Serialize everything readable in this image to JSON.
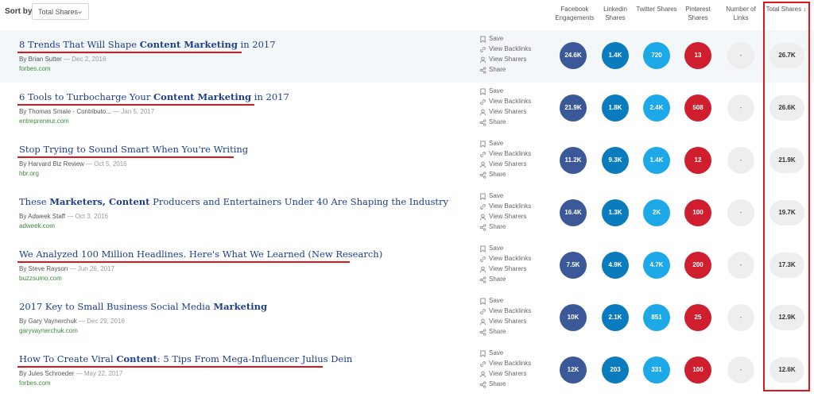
{
  "sort": {
    "label": "Sort by",
    "selected": "Total Shares"
  },
  "columns": {
    "facebook": "Facebook Engagements",
    "linkedin": "Linkedin Shares",
    "twitter": "Twitter Shares",
    "pinterest": "Pinterest Shares",
    "links": "Number of Links",
    "total": "Total Shares ↓"
  },
  "actions": {
    "save": "Save",
    "backlinks": "View Backlinks",
    "sharers": "View Sharers",
    "share": "Share"
  },
  "colors": {
    "facebook": "#3b5998",
    "linkedin": "#0a7bbc",
    "twitter": "#1da8e8",
    "pinterest": "#cf1f2e",
    "highlight": "#e0161e",
    "title": "#1f3e8c",
    "domain": "#3f8c3f"
  },
  "articles": [
    {
      "title_parts": [
        [
          "8 Trends That Will Shape ",
          false
        ],
        [
          "Content Marketing",
          true
        ],
        [
          " in 2017",
          false
        ]
      ],
      "underlined": true,
      "author": "By Brian Sutter",
      "date": "— Dec 2, 2016",
      "domain": "forbes.com",
      "facebook": "24.6K",
      "linkedin": "1.4K",
      "twitter": "720",
      "pinterest": "13",
      "links": "-",
      "total": "26.7K"
    },
    {
      "title_parts": [
        [
          "6 Tools to Turbocharge Your ",
          false
        ],
        [
          "Content Marketing",
          true
        ],
        [
          " in 2017",
          false
        ]
      ],
      "underlined": true,
      "author": "By Thomas Smale - Contributo...",
      "date": "— Jan 5, 2017",
      "domain": "entrepreneur.com",
      "facebook": "21.9K",
      "linkedin": "1.8K",
      "twitter": "2.4K",
      "pinterest": "508",
      "links": "-",
      "total": "26.6K"
    },
    {
      "title_parts": [
        [
          "Stop Trying to Sound Smart When You're Writing",
          false
        ]
      ],
      "underlined": true,
      "author": "By Harvard Biz Review",
      "date": "— Oct 5, 2016",
      "domain": "hbr.org",
      "facebook": "11.2K",
      "linkedin": "9.3K",
      "twitter": "1.4K",
      "pinterest": "12",
      "links": "-",
      "total": "21.9K"
    },
    {
      "title_parts": [
        [
          "These ",
          false
        ],
        [
          "Marketers, Content",
          true
        ],
        [
          " Producers and Entertainers Under 40 Are Shaping the Industry",
          false
        ]
      ],
      "underlined": false,
      "author": "By Adweek Staff",
      "date": "— Oct 3, 2016",
      "domain": "adweek.com",
      "facebook": "16.4K",
      "linkedin": "1.3K",
      "twitter": "2K",
      "pinterest": "100",
      "links": "-",
      "total": "19.7K"
    },
    {
      "title_parts": [
        [
          "We Analyzed 100 Million Headlines. Here's What We Learned (New Research)",
          false
        ]
      ],
      "underlined": true,
      "author": "By Steve Rayson",
      "date": "— Jun 26, 2017",
      "domain": "buzzsumo.com",
      "facebook": "7.5K",
      "linkedin": "4.9K",
      "twitter": "4.7K",
      "pinterest": "200",
      "links": "-",
      "total": "17.3K"
    },
    {
      "title_parts": [
        [
          "2017 Key to Small Business Social Media ",
          false
        ],
        [
          "Marketing",
          true
        ]
      ],
      "underlined": false,
      "author": "By Gary Vaynerchuk",
      "date": "— Dec 29, 2016",
      "domain": "garyvaynerchuk.com",
      "facebook": "10K",
      "linkedin": "2.1K",
      "twitter": "851",
      "pinterest": "25",
      "links": "-",
      "total": "12.9K"
    },
    {
      "title_parts": [
        [
          "How To Create Viral ",
          false
        ],
        [
          "Content",
          true
        ],
        [
          ": 5 Tips From Mega-Influencer Julius Dein",
          false
        ]
      ],
      "underlined": true,
      "author": "By Jules Schroeder",
      "date": "— May 22, 2017",
      "domain": "forbes.com",
      "facebook": "12K",
      "linkedin": "203",
      "twitter": "331",
      "pinterest": "100",
      "links": "-",
      "total": "12.6K"
    }
  ]
}
